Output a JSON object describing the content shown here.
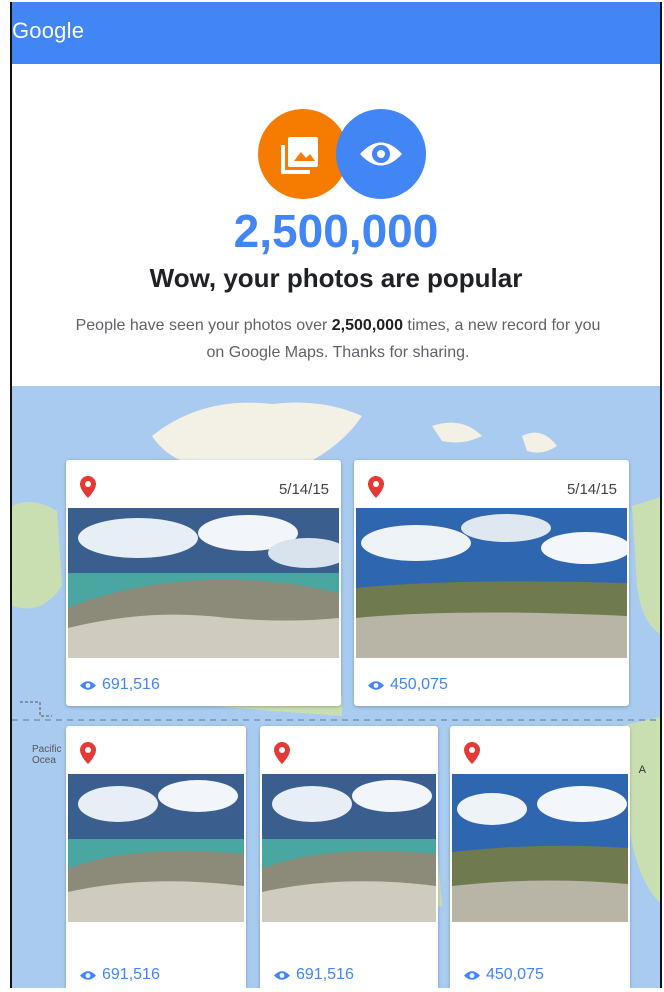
{
  "header": {
    "brand": "Google"
  },
  "hero": {
    "count": "2,500,000",
    "title": "Wow, your photos are popular",
    "desc_before": "People have seen your photos over ",
    "desc_count": "2,500,000",
    "desc_after": " times, a new record for you on Google Maps. Thanks for sharing."
  },
  "map": {
    "label_pacific": "Pacific\nOcea",
    "label_a": "A"
  },
  "cards": [
    {
      "date": "5/14/15",
      "views": "691,516"
    },
    {
      "date": "5/14/15",
      "views": "450,075"
    },
    {
      "date": "",
      "views": "691,516"
    },
    {
      "date": "",
      "views": "691,516"
    },
    {
      "date": "",
      "views": "450,075"
    }
  ],
  "colors": {
    "accent": "#4285f4",
    "orange": "#f57c00",
    "pin": "#e53935"
  }
}
